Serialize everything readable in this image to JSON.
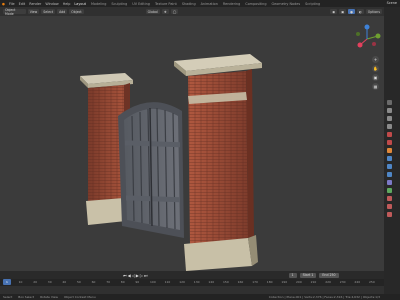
{
  "app": {
    "scene_label": "Scene"
  },
  "topbar": {
    "menus": [
      "File",
      "Edit",
      "Render",
      "Window",
      "Help"
    ],
    "workspaces": [
      "Layout",
      "Modeling",
      "Sculpting",
      "UV Editing",
      "Texture Paint",
      "Shading",
      "Animation",
      "Rendering",
      "Compositing",
      "Geometry Nodes",
      "Scripting"
    ],
    "active_workspace_index": 0
  },
  "viewport_header": {
    "mode": "Object Mode",
    "buttons": [
      "View",
      "Select",
      "Add",
      "Object"
    ],
    "transform": "Global"
  },
  "outliner_label": "Options",
  "timeline": {
    "current_frame": "1",
    "start_label": "Start",
    "start_value": "1",
    "end_label": "End",
    "end_value": "250",
    "ruler_ticks": [
      "0",
      "10",
      "20",
      "30",
      "40",
      "50",
      "60",
      "70",
      "80",
      "90",
      "100",
      "110",
      "120",
      "130",
      "140",
      "150",
      "160",
      "170",
      "180",
      "190",
      "200",
      "210",
      "220",
      "230",
      "240",
      "250"
    ]
  },
  "statusbar": {
    "left": [
      "Select",
      "Box Select",
      "Rotate View",
      "Object Context Menu"
    ],
    "right": "Collection | Plane.001 | Verts:2,376 | Faces:2,316 | Tris:4,632 | Objects:1/3"
  },
  "colors": {
    "accent": "#4772b3",
    "brick": "#9a4a36",
    "stone": "#cfc5ad",
    "iron": "#5e6168"
  }
}
